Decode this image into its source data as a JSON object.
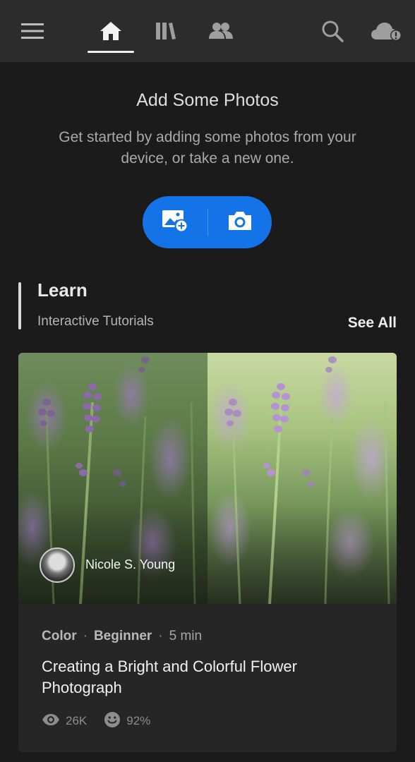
{
  "header": {
    "nav": [
      {
        "name": "menu-icon"
      },
      {
        "name": "home-icon",
        "active": true
      },
      {
        "name": "library-icon"
      },
      {
        "name": "people-icon"
      },
      {
        "name": "search-icon"
      },
      {
        "name": "cloud-alert-icon"
      }
    ]
  },
  "empty_state": {
    "title": "Add Some Photos",
    "subtitle": "Get started by adding some photos from your device, or take a new one.",
    "add_photo_icon": "add-photo-icon",
    "camera_icon": "camera-icon",
    "accent_color": "#1473e6"
  },
  "learn": {
    "title": "Learn",
    "subtitle": "Interactive Tutorials",
    "see_all": "See All",
    "card": {
      "author": "Nicole S. Young",
      "category": "Color",
      "level": "Beginner",
      "duration": "5 min",
      "title": "Creating a Bright and Colorful Flower Photograph",
      "views": "26K",
      "rating": "92%"
    }
  }
}
